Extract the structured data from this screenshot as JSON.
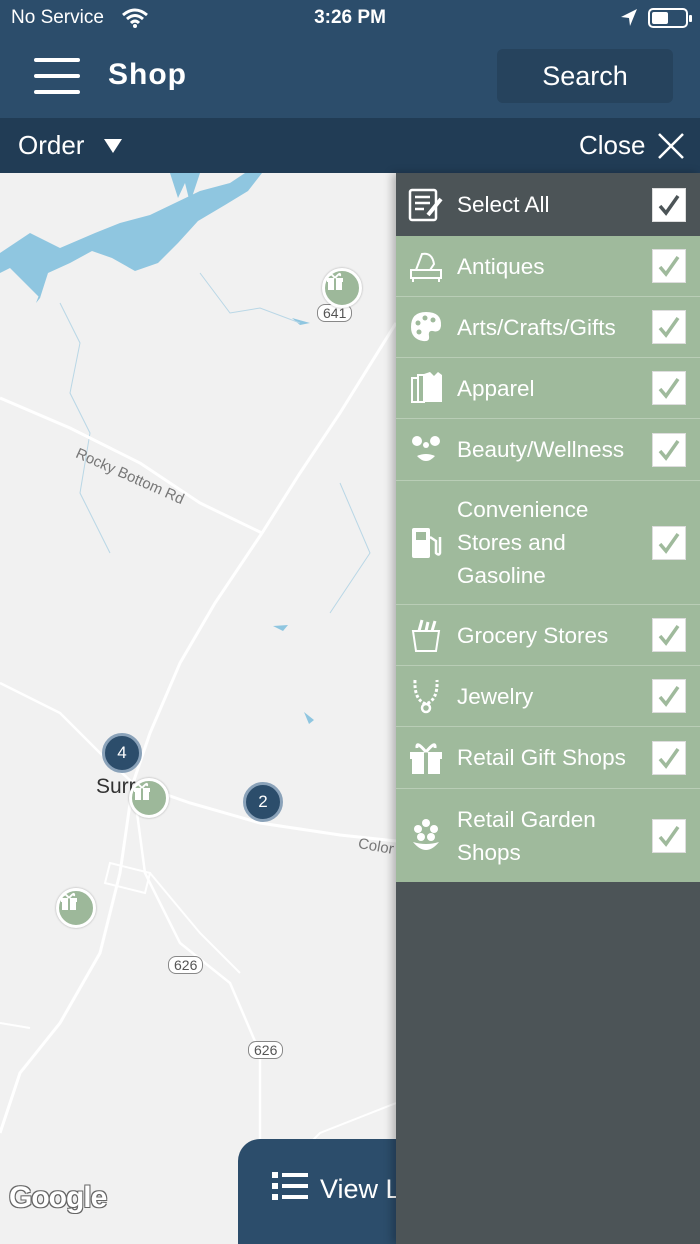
{
  "status_bar": {
    "carrier": "No Service",
    "time": "3:26 PM"
  },
  "header": {
    "title": "Shop",
    "search_label": "Search"
  },
  "order_bar": {
    "order_label": "Order",
    "close_label": "Close"
  },
  "map": {
    "road_labels": [
      "Rocky Bottom Rd",
      "Color"
    ],
    "route_shields": [
      "641",
      "626",
      "626"
    ],
    "town_label": "Surr",
    "clusters": [
      "4",
      "2"
    ],
    "attribution": "Google",
    "view_list_label": "View L"
  },
  "filter_panel": {
    "select_all_label": "Select All",
    "categories": [
      {
        "label": "Antiques",
        "icon": "antiques-icon",
        "checked": true
      },
      {
        "label": "Arts/Crafts/Gifts",
        "icon": "palette-icon",
        "checked": true
      },
      {
        "label": "Apparel",
        "icon": "apparel-icon",
        "checked": true
      },
      {
        "label": "Beauty/Wellness",
        "icon": "beauty-icon",
        "checked": true
      },
      {
        "label": "Convenience Stores and Gasoline",
        "icon": "gas-pump-icon",
        "checked": true
      },
      {
        "label": "Grocery Stores",
        "icon": "grocery-bag-icon",
        "checked": true
      },
      {
        "label": "Jewelry",
        "icon": "necklace-icon",
        "checked": true
      },
      {
        "label": "Retail Gift Shops",
        "icon": "gift-icon",
        "checked": true
      },
      {
        "label": "Retail Garden Shops",
        "icon": "flower-icon",
        "checked": true
      }
    ]
  },
  "colors": {
    "header": "#2c4d6b",
    "order_bar": "#213c55",
    "panel_dark": "#4c5457",
    "panel_green": "#9fba9c",
    "water": "#8fc6e0"
  }
}
